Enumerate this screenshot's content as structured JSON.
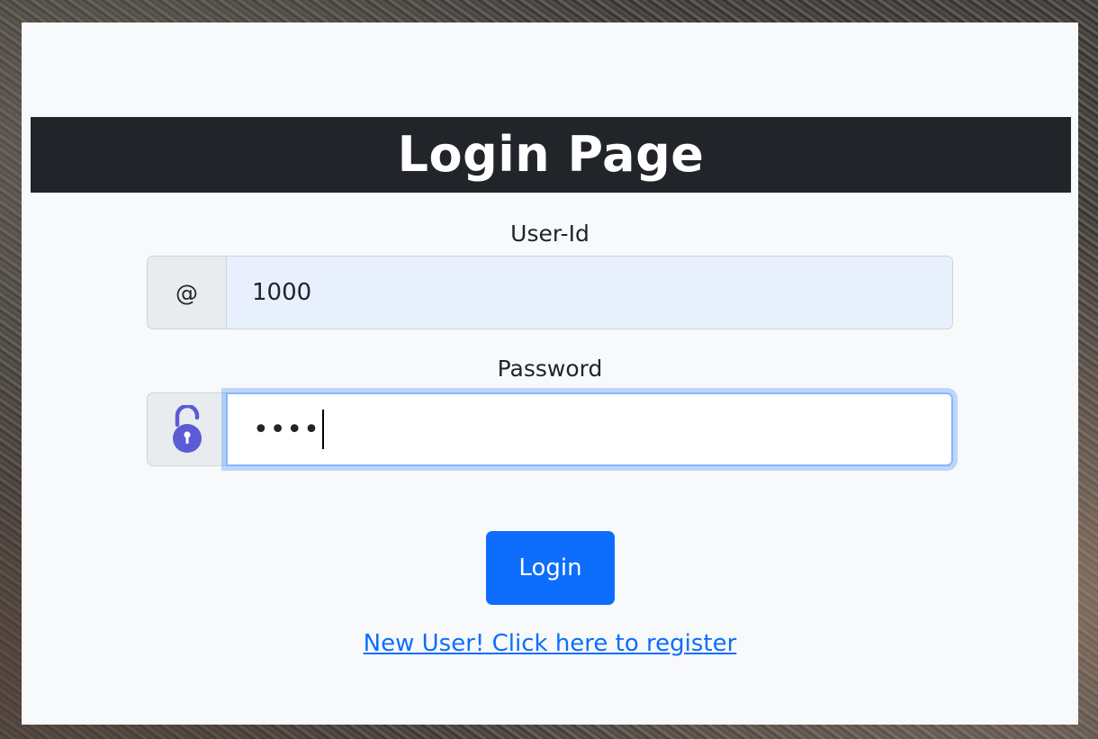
{
  "header": {
    "title": "Login Page"
  },
  "form": {
    "user_label": "User-Id",
    "user_addon": "@",
    "user_value": "1000",
    "password_label": "Password",
    "password_value": "••••",
    "login_button": "Login",
    "register_link": "New User! Click here to register"
  },
  "icons": {
    "user_addon_icon": "at-icon",
    "password_addon_icon": "unlocked-padlock-icon"
  },
  "colors": {
    "primary": "#0d6efd",
    "header_bg": "#212529",
    "card_bg": "#f8f9fa",
    "padlock": "#5b5bd6"
  }
}
